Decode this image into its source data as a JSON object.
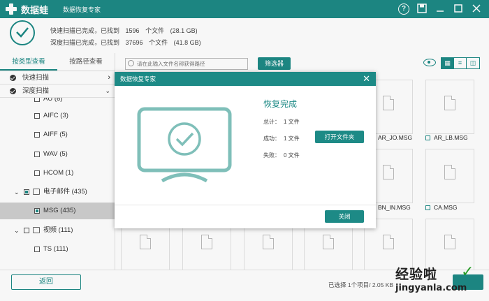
{
  "app": {
    "brand": "数据蛙",
    "title": "数据恢复专家"
  },
  "summary": {
    "quick": {
      "text": "快速扫描已完成，已找到",
      "count": "1596",
      "unit": "个文件",
      "size": "(28.1 GB)"
    },
    "deep": {
      "text": "深度扫描已完成，已找到",
      "count": "37696",
      "unit": "个文件",
      "size": "(41.8 GB)"
    }
  },
  "left": {
    "tabs": [
      "按类型查看",
      "按路径查看"
    ],
    "sections": [
      "快速扫描",
      "深度扫描"
    ],
    "tree": [
      {
        "label": "AU (6)"
      },
      {
        "label": "AIFC (3)"
      },
      {
        "label": "AIFF (5)"
      },
      {
        "label": "WAV (5)"
      },
      {
        "label": "HCOM (1)"
      },
      {
        "label": "电子邮件 (435)"
      },
      {
        "label": "MSG (435)"
      },
      {
        "label": "视频 (111)"
      },
      {
        "label": "TS (111)"
      }
    ]
  },
  "toolbar": {
    "search_placeholder": "请在此输入文件名称获得路径",
    "filter_label": "筛选器",
    "view_icons": [
      "grid-view-icon",
      "list-view-icon",
      "column-view-icon"
    ]
  },
  "grid": {
    "files": [
      "AR_JO.MSG",
      "AR_LB.MSG",
      "BN_IN.MSG",
      "CA.MSG"
    ]
  },
  "dialog": {
    "title": "数据恢复专家",
    "heading": "恢复完成",
    "total_label": "总计：",
    "total_value": "1 文件",
    "success_label": "成功：",
    "success_value": "1 文件",
    "fail_label": "失败：",
    "fail_value": "0 文件",
    "open_folder_label": "打开文件夹",
    "close_label": "关闭"
  },
  "bottom": {
    "back_label": "返回",
    "selected_info": "已选择 1个项目/ 2.05 KB"
  },
  "watermark": {
    "main": "经验啦",
    "sub": "jingyanla.com"
  },
  "colors": {
    "accent": "#1d8a86"
  }
}
